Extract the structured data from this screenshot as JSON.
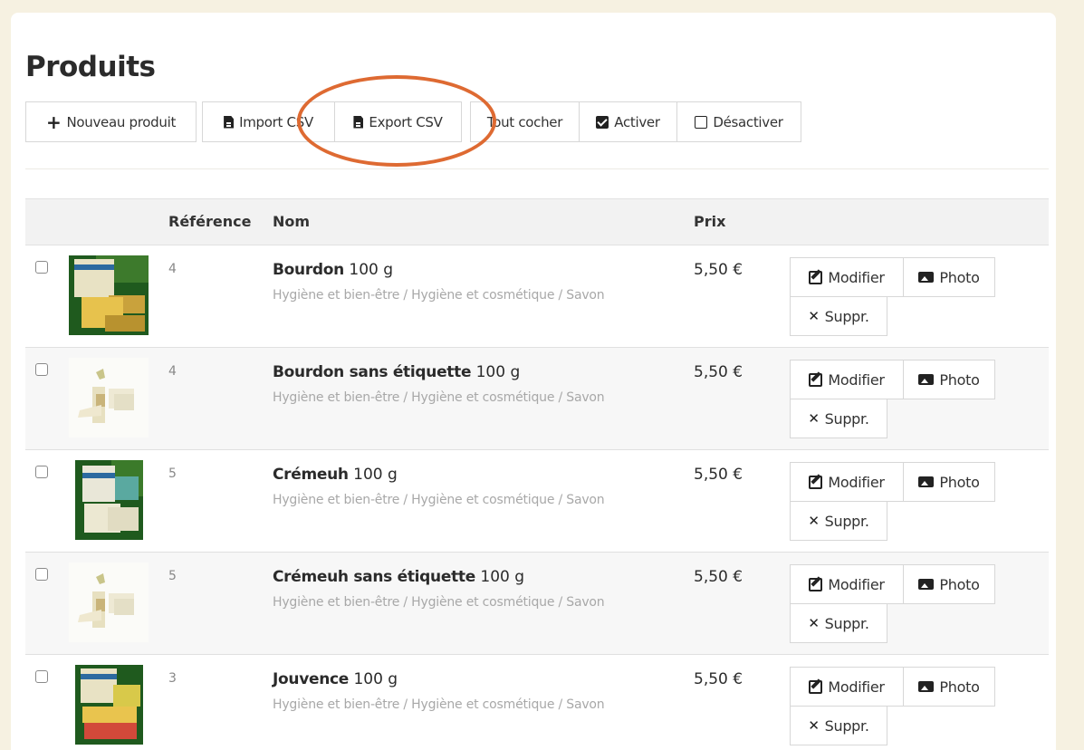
{
  "page": {
    "title": "Produits"
  },
  "toolbar": {
    "new_product": "Nouveau produit",
    "import_csv": "Import CSV",
    "export_csv": "Export CSV",
    "check_all": "Tout cocher",
    "activate": "Activer",
    "deactivate": "Désactiver"
  },
  "highlight": {
    "color": "#de6a32",
    "target": "Export CSV"
  },
  "table": {
    "columns": {
      "reference": "Référence",
      "name": "Nom",
      "price": "Prix"
    },
    "actions": {
      "edit": "Modifier",
      "photo": "Photo",
      "delete": "Suppr."
    },
    "rows": [
      {
        "checked": false,
        "reference": "4",
        "name": "Bourdon",
        "weight": "100 g",
        "category": "Hygiène et bien-être / Hygiène et cosmétique / Savon",
        "price": "5,50 €"
      },
      {
        "checked": false,
        "reference": "4",
        "name": "Bourdon sans étiquette",
        "weight": "100 g",
        "category": "Hygiène et bien-être / Hygiène et cosmétique / Savon",
        "price": "5,50 €"
      },
      {
        "checked": false,
        "reference": "5",
        "name": "Crémeuh",
        "weight": "100 g",
        "category": "Hygiène et bien-être / Hygiène et cosmétique / Savon",
        "price": "5,50 €"
      },
      {
        "checked": false,
        "reference": "5",
        "name": "Crémeuh sans étiquette",
        "weight": "100 g",
        "category": "Hygiène et bien-être / Hygiène et cosmétique / Savon",
        "price": "5,50 €"
      },
      {
        "checked": false,
        "reference": "3",
        "name": "Jouvence",
        "weight": "100 g",
        "category": "Hygiène et bien-être / Hygiène et cosmétique / Savon",
        "price": "5,50 €"
      }
    ]
  },
  "colors": {
    "page_background": "#f6f1e1",
    "panel_background": "#ffffff",
    "header_background": "#f2f2f2",
    "category_text": "#a8a8a8"
  }
}
